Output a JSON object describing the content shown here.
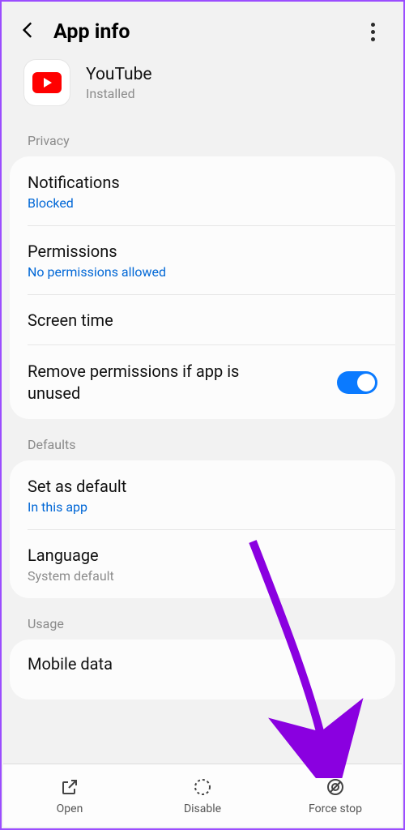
{
  "header": {
    "title": "App info"
  },
  "app": {
    "name": "YouTube",
    "status": "Installed"
  },
  "sections": {
    "privacy_label": "Privacy",
    "defaults_label": "Defaults",
    "usage_label": "Usage"
  },
  "privacy": {
    "notifications": {
      "title": "Notifications",
      "sub": "Blocked"
    },
    "permissions": {
      "title": "Permissions",
      "sub": "No permissions allowed"
    },
    "screen_time": {
      "title": "Screen time"
    },
    "remove_perms": {
      "title": "Remove permissions if app is unused",
      "toggle_on": true
    }
  },
  "defaults": {
    "set_default": {
      "title": "Set as default",
      "sub": "In this app"
    },
    "language": {
      "title": "Language",
      "sub": "System default"
    }
  },
  "usage": {
    "mobile_data": {
      "title": "Mobile data"
    }
  },
  "bottombar": {
    "open": "Open",
    "disable": "Disable",
    "force_stop": "Force stop"
  },
  "colors": {
    "accent_blue": "#0a7aff",
    "link_blue": "#0067d6",
    "arrow": "#8a00e0"
  }
}
